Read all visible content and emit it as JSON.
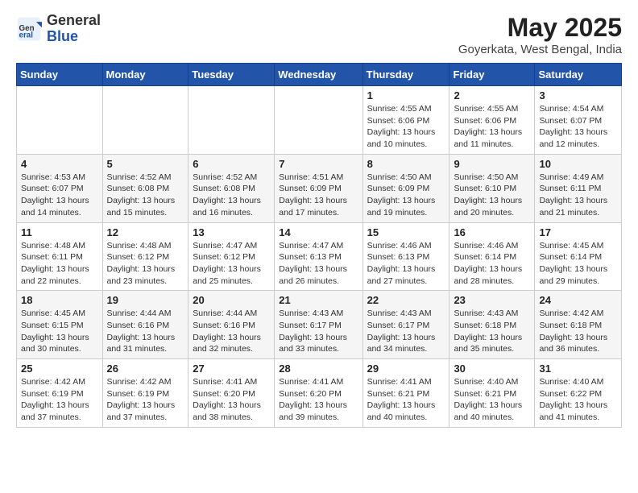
{
  "header": {
    "logo_general": "General",
    "logo_blue": "Blue",
    "title": "May 2025",
    "location": "Goyerkata, West Bengal, India"
  },
  "weekdays": [
    "Sunday",
    "Monday",
    "Tuesday",
    "Wednesday",
    "Thursday",
    "Friday",
    "Saturday"
  ],
  "weeks": [
    [
      {
        "day": "",
        "info": ""
      },
      {
        "day": "",
        "info": ""
      },
      {
        "day": "",
        "info": ""
      },
      {
        "day": "",
        "info": ""
      },
      {
        "day": "1",
        "info": "Sunrise: 4:55 AM\nSunset: 6:06 PM\nDaylight: 13 hours\nand 10 minutes."
      },
      {
        "day": "2",
        "info": "Sunrise: 4:55 AM\nSunset: 6:06 PM\nDaylight: 13 hours\nand 11 minutes."
      },
      {
        "day": "3",
        "info": "Sunrise: 4:54 AM\nSunset: 6:07 PM\nDaylight: 13 hours\nand 12 minutes."
      }
    ],
    [
      {
        "day": "4",
        "info": "Sunrise: 4:53 AM\nSunset: 6:07 PM\nDaylight: 13 hours\nand 14 minutes."
      },
      {
        "day": "5",
        "info": "Sunrise: 4:52 AM\nSunset: 6:08 PM\nDaylight: 13 hours\nand 15 minutes."
      },
      {
        "day": "6",
        "info": "Sunrise: 4:52 AM\nSunset: 6:08 PM\nDaylight: 13 hours\nand 16 minutes."
      },
      {
        "day": "7",
        "info": "Sunrise: 4:51 AM\nSunset: 6:09 PM\nDaylight: 13 hours\nand 17 minutes."
      },
      {
        "day": "8",
        "info": "Sunrise: 4:50 AM\nSunset: 6:09 PM\nDaylight: 13 hours\nand 19 minutes."
      },
      {
        "day": "9",
        "info": "Sunrise: 4:50 AM\nSunset: 6:10 PM\nDaylight: 13 hours\nand 20 minutes."
      },
      {
        "day": "10",
        "info": "Sunrise: 4:49 AM\nSunset: 6:11 PM\nDaylight: 13 hours\nand 21 minutes."
      }
    ],
    [
      {
        "day": "11",
        "info": "Sunrise: 4:48 AM\nSunset: 6:11 PM\nDaylight: 13 hours\nand 22 minutes."
      },
      {
        "day": "12",
        "info": "Sunrise: 4:48 AM\nSunset: 6:12 PM\nDaylight: 13 hours\nand 23 minutes."
      },
      {
        "day": "13",
        "info": "Sunrise: 4:47 AM\nSunset: 6:12 PM\nDaylight: 13 hours\nand 25 minutes."
      },
      {
        "day": "14",
        "info": "Sunrise: 4:47 AM\nSunset: 6:13 PM\nDaylight: 13 hours\nand 26 minutes."
      },
      {
        "day": "15",
        "info": "Sunrise: 4:46 AM\nSunset: 6:13 PM\nDaylight: 13 hours\nand 27 minutes."
      },
      {
        "day": "16",
        "info": "Sunrise: 4:46 AM\nSunset: 6:14 PM\nDaylight: 13 hours\nand 28 minutes."
      },
      {
        "day": "17",
        "info": "Sunrise: 4:45 AM\nSunset: 6:14 PM\nDaylight: 13 hours\nand 29 minutes."
      }
    ],
    [
      {
        "day": "18",
        "info": "Sunrise: 4:45 AM\nSunset: 6:15 PM\nDaylight: 13 hours\nand 30 minutes."
      },
      {
        "day": "19",
        "info": "Sunrise: 4:44 AM\nSunset: 6:16 PM\nDaylight: 13 hours\nand 31 minutes."
      },
      {
        "day": "20",
        "info": "Sunrise: 4:44 AM\nSunset: 6:16 PM\nDaylight: 13 hours\nand 32 minutes."
      },
      {
        "day": "21",
        "info": "Sunrise: 4:43 AM\nSunset: 6:17 PM\nDaylight: 13 hours\nand 33 minutes."
      },
      {
        "day": "22",
        "info": "Sunrise: 4:43 AM\nSunset: 6:17 PM\nDaylight: 13 hours\nand 34 minutes."
      },
      {
        "day": "23",
        "info": "Sunrise: 4:43 AM\nSunset: 6:18 PM\nDaylight: 13 hours\nand 35 minutes."
      },
      {
        "day": "24",
        "info": "Sunrise: 4:42 AM\nSunset: 6:18 PM\nDaylight: 13 hours\nand 36 minutes."
      }
    ],
    [
      {
        "day": "25",
        "info": "Sunrise: 4:42 AM\nSunset: 6:19 PM\nDaylight: 13 hours\nand 37 minutes."
      },
      {
        "day": "26",
        "info": "Sunrise: 4:42 AM\nSunset: 6:19 PM\nDaylight: 13 hours\nand 37 minutes."
      },
      {
        "day": "27",
        "info": "Sunrise: 4:41 AM\nSunset: 6:20 PM\nDaylight: 13 hours\nand 38 minutes."
      },
      {
        "day": "28",
        "info": "Sunrise: 4:41 AM\nSunset: 6:20 PM\nDaylight: 13 hours\nand 39 minutes."
      },
      {
        "day": "29",
        "info": "Sunrise: 4:41 AM\nSunset: 6:21 PM\nDaylight: 13 hours\nand 40 minutes."
      },
      {
        "day": "30",
        "info": "Sunrise: 4:40 AM\nSunset: 6:21 PM\nDaylight: 13 hours\nand 40 minutes."
      },
      {
        "day": "31",
        "info": "Sunrise: 4:40 AM\nSunset: 6:22 PM\nDaylight: 13 hours\nand 41 minutes."
      }
    ]
  ]
}
